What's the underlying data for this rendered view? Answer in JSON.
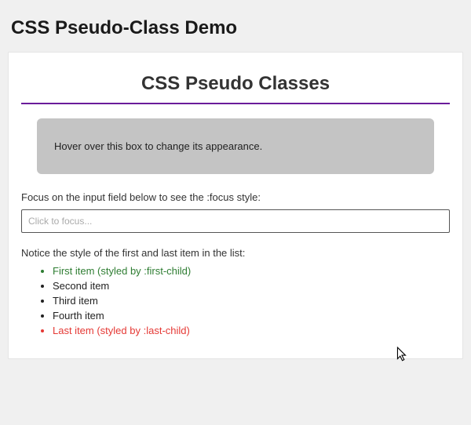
{
  "page": {
    "heading": "CSS Pseudo-Class Demo"
  },
  "card": {
    "title": "CSS Pseudo Classes",
    "hover_box_text": "Hover over this box to change its appearance.",
    "focus_prompt": "Focus on the input field below to see the :focus style:",
    "input_placeholder": "Click to focus...",
    "list_prompt": "Notice the style of the first and last item in the list:",
    "list_items": [
      "First item (styled by :first-child)",
      "Second item",
      "Third item",
      "Fourth item",
      "Last item (styled by :last-child)"
    ]
  },
  "colors": {
    "accent": "#6a1b9a",
    "first_child": "#2e7d32",
    "last_child": "#e53935",
    "hover_box_bg": "#c4c4c4"
  }
}
